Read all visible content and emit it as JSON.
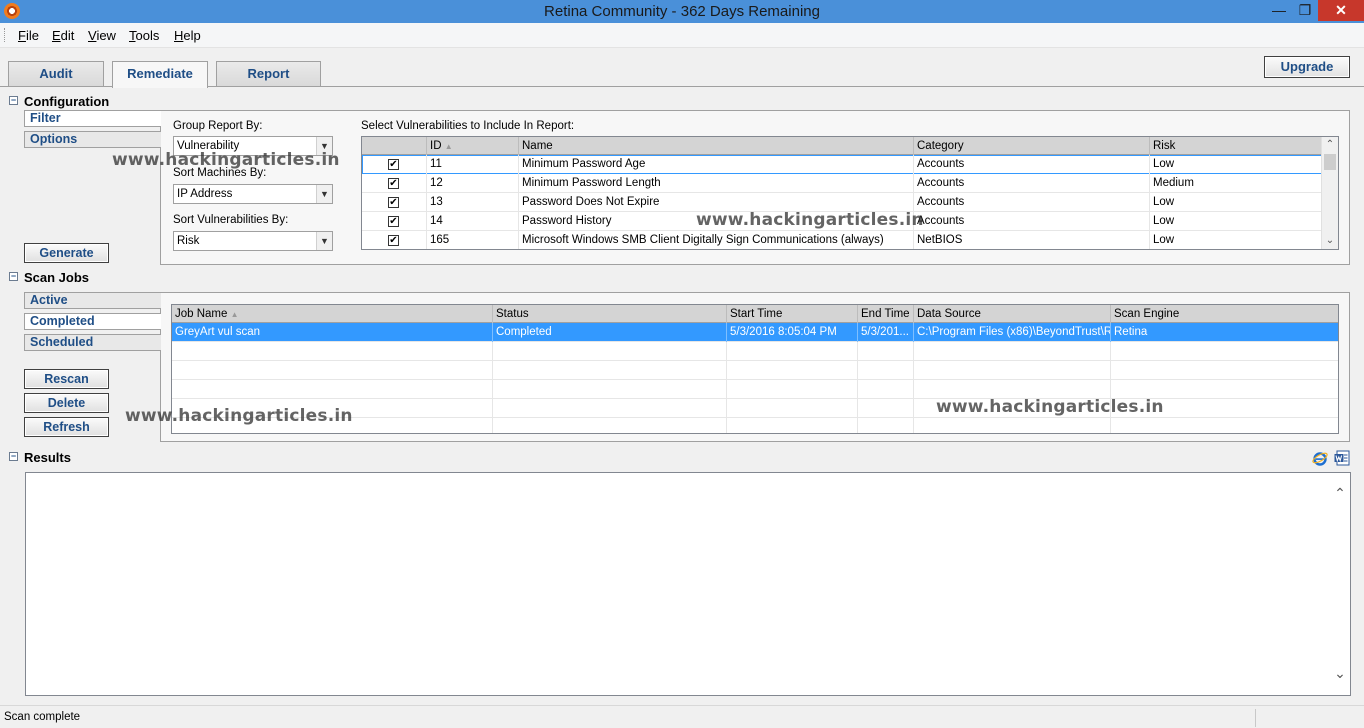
{
  "window": {
    "title": "Retina Community - 362  Days Remaining",
    "minimize": "—",
    "maximize": "❐",
    "close": "✕"
  },
  "menu": {
    "items": [
      {
        "underline": "F",
        "rest": "ile"
      },
      {
        "underline": "E",
        "rest": "dit"
      },
      {
        "underline": "V",
        "rest": "iew"
      },
      {
        "underline": "T",
        "rest": "ools"
      },
      {
        "underline": "H",
        "rest": "elp"
      }
    ]
  },
  "tabs": [
    {
      "label": "Audit",
      "active": false
    },
    {
      "label": "Remediate",
      "active": true
    },
    {
      "label": "Report",
      "active": false
    }
  ],
  "upgrade_label": "Upgrade",
  "configuration": {
    "title": "Configuration",
    "toggle": "−",
    "side_links": [
      "Filter",
      "Options"
    ],
    "generate_label": "Generate",
    "group_report_label": "Group Report By:",
    "group_report_value": "Vulnerability",
    "sort_machines_label": "Sort Machines By:",
    "sort_machines_value": "IP Address",
    "sort_vulns_label": "Sort Vulnerabilities By:",
    "sort_vulns_value": "Risk",
    "select_label": "Select Vulnerabilities to Include In Report:",
    "vuln_columns": [
      "",
      "ID",
      "Name",
      "Category",
      "Risk"
    ],
    "sort_indicator": "▲",
    "vulnerabilities": [
      {
        "checked": "✔",
        "id": "11",
        "name": "Minimum Password Age",
        "category": "Accounts",
        "risk": "Low"
      },
      {
        "checked": "✔",
        "id": "12",
        "name": "Minimum Password Length",
        "category": "Accounts",
        "risk": "Medium"
      },
      {
        "checked": "✔",
        "id": "13",
        "name": "Password Does Not Expire",
        "category": "Accounts",
        "risk": "Low"
      },
      {
        "checked": "✔",
        "id": "14",
        "name": "Password History",
        "category": "Accounts",
        "risk": "Low"
      },
      {
        "checked": "✔",
        "id": "165",
        "name": "Microsoft Windows SMB Client Digitally Sign Communications (always)",
        "category": "NetBIOS",
        "risk": "Low"
      }
    ]
  },
  "scan_jobs": {
    "title": "Scan Jobs",
    "toggle": "−",
    "side_links": [
      "Active",
      "Completed",
      "Scheduled"
    ],
    "buttons": [
      "Rescan",
      "Delete",
      "Refresh"
    ],
    "columns": [
      "Job Name",
      "Status",
      "Start Time",
      "End Time",
      "Data Source",
      "Scan Engine"
    ],
    "sort_indicator": "▲",
    "rows": [
      {
        "job_name": "GreyArt vul scan",
        "status": "Completed",
        "start_time": "5/3/2016 8:05:04 PM",
        "end_time": "5/3/201...",
        "data_source": "C:\\Program Files (x86)\\BeyondTrust\\R...",
        "scan_engine": "Retina"
      }
    ]
  },
  "results": {
    "title": "Results",
    "toggle": "−"
  },
  "watermarks": [
    "www.hackingarticles.in",
    "www.hackingarticles.in",
    "www.hackingarticles.in",
    "www.hackingarticles.in"
  ],
  "status": {
    "text": "Scan complete"
  },
  "icons": {
    "scroll_up": "⌃",
    "scroll_down": "⌄",
    "combo_arrow": "▼"
  },
  "colors": {
    "titlebar": "#4a90d9",
    "accent_text": "#1f4e86",
    "selection": "#3399ff",
    "close": "#c7372b"
  }
}
